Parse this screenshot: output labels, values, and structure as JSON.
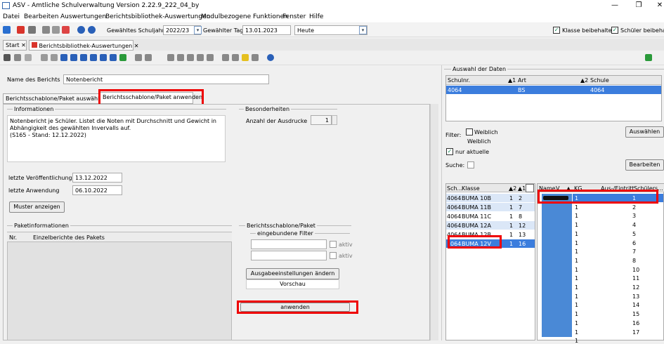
{
  "window": {
    "title": "ASV - Amtliche Schulverwaltung Version 2.22.9_222_04_by",
    "minimize": "—",
    "maximize": "❐",
    "close": "✕"
  },
  "menu": [
    "Datei",
    "Bearbeiten",
    "Auswertungen",
    "Berichtsbibliothek-Auswertungen",
    "Modulbezogene Funktionen",
    "Fenster",
    "Hilfe"
  ],
  "toolbar": {
    "schuljahr_label": "Gewähltes Schuljahr",
    "schuljahr_value": "2022/23",
    "tag_label": "Gewählter Tag",
    "tag_value": "13.01.2023",
    "heute_value": "Heute",
    "klasse_beibehalten": "Klasse beibehalten",
    "schueler_beibehalten": "Schüler beibehalten"
  },
  "tabs": [
    {
      "label": "Start"
    },
    {
      "label": "Berichtsbibliothek-Auswertungen"
    }
  ],
  "report": {
    "name_label": "Name des Berichts",
    "name_value": "Notenbericht",
    "subtab1": "Berichtsschablone/Paket auswählen",
    "subtab2": "Berichtsschablone/Paket anwenden",
    "info_title": "Informationen",
    "info_text": "Notenbericht je Schüler. Listet die Noten mit Durchschnitt und Gewicht in Abhängigkeit des gewählten Invervalls auf.\n(S165 - Stand: 12.12.2022)",
    "besonderheiten_title": "Besonderheiten",
    "anzahl_label": "Anzahl der Ausdrucke",
    "anzahl_value": "1",
    "veroeff_label": "letzte Veröffentlichung",
    "veroeff_value": "13.12.2022",
    "anwendung_label": "letzte Anwendung",
    "anwendung_value": "06.10.2022",
    "muster_button": "Muster anzeigen",
    "paketinfo_title": "Paketinformationen",
    "col_nr": "Nr.",
    "col_einzel": "Einzelberichte des Pakets",
    "schablone_title": "Berichtsschablone/Paket",
    "filter_title": "eingebundene Filter",
    "aktiv1": "aktiv",
    "aktiv2": "aktiv",
    "ausgabe_button": "Ausgabeeinstellungen ändern",
    "vorschau_label": "Vorschau",
    "anwenden_button": "anwenden"
  },
  "right": {
    "auswahl_title": "Auswahl der Daten",
    "schul_headers": [
      "Schulnr.",
      "Art",
      "Schule"
    ],
    "schul_sort": [
      "",
      "▲1",
      "▲2"
    ],
    "schul_row": [
      "4064",
      "BS",
      "4064"
    ],
    "filter_label": "Filter:",
    "weiblich_chk": "Weiblich",
    "weiblich_text": "Weiblich",
    "nur_aktuelle": "nur aktuelle",
    "suche_label": "Suche:",
    "auswaehlen_button": "Auswählen",
    "bearbeiten_button": "Bearbeiten",
    "klassen_headers": [
      "Sch...",
      "Klasse",
      "▲2",
      "▲1"
    ],
    "klassen_rows": [
      [
        "4064",
        "BUMA 10B",
        "1",
        "2"
      ],
      [
        "4064",
        "BUMA 11B",
        "1",
        "7"
      ],
      [
        "4064",
        "BUMA 11C",
        "1",
        "8"
      ],
      [
        "4064",
        "BUMA 12A",
        "1",
        "12"
      ],
      [
        "4064",
        "BUMA 12B",
        "1",
        "13"
      ],
      [
        "064",
        "BUMA 12V",
        "1",
        "16"
      ]
    ],
    "schueler_headers": [
      "Name",
      "V",
      "▲",
      "KG",
      "Aus-/Eintritt",
      "Schülers..."
    ],
    "schueler_kg": [
      "1",
      "1",
      "1",
      "1",
      "1",
      "1",
      "1",
      "1",
      "1",
      "1",
      "1",
      "1",
      "1",
      "1",
      "1",
      "1",
      "1"
    ],
    "schueler_nums": [
      "1",
      "2",
      "3",
      "4",
      "5",
      "6",
      "7",
      "8",
      "10",
      "11",
      "12",
      "13",
      "14",
      "15",
      "16",
      "17"
    ]
  }
}
